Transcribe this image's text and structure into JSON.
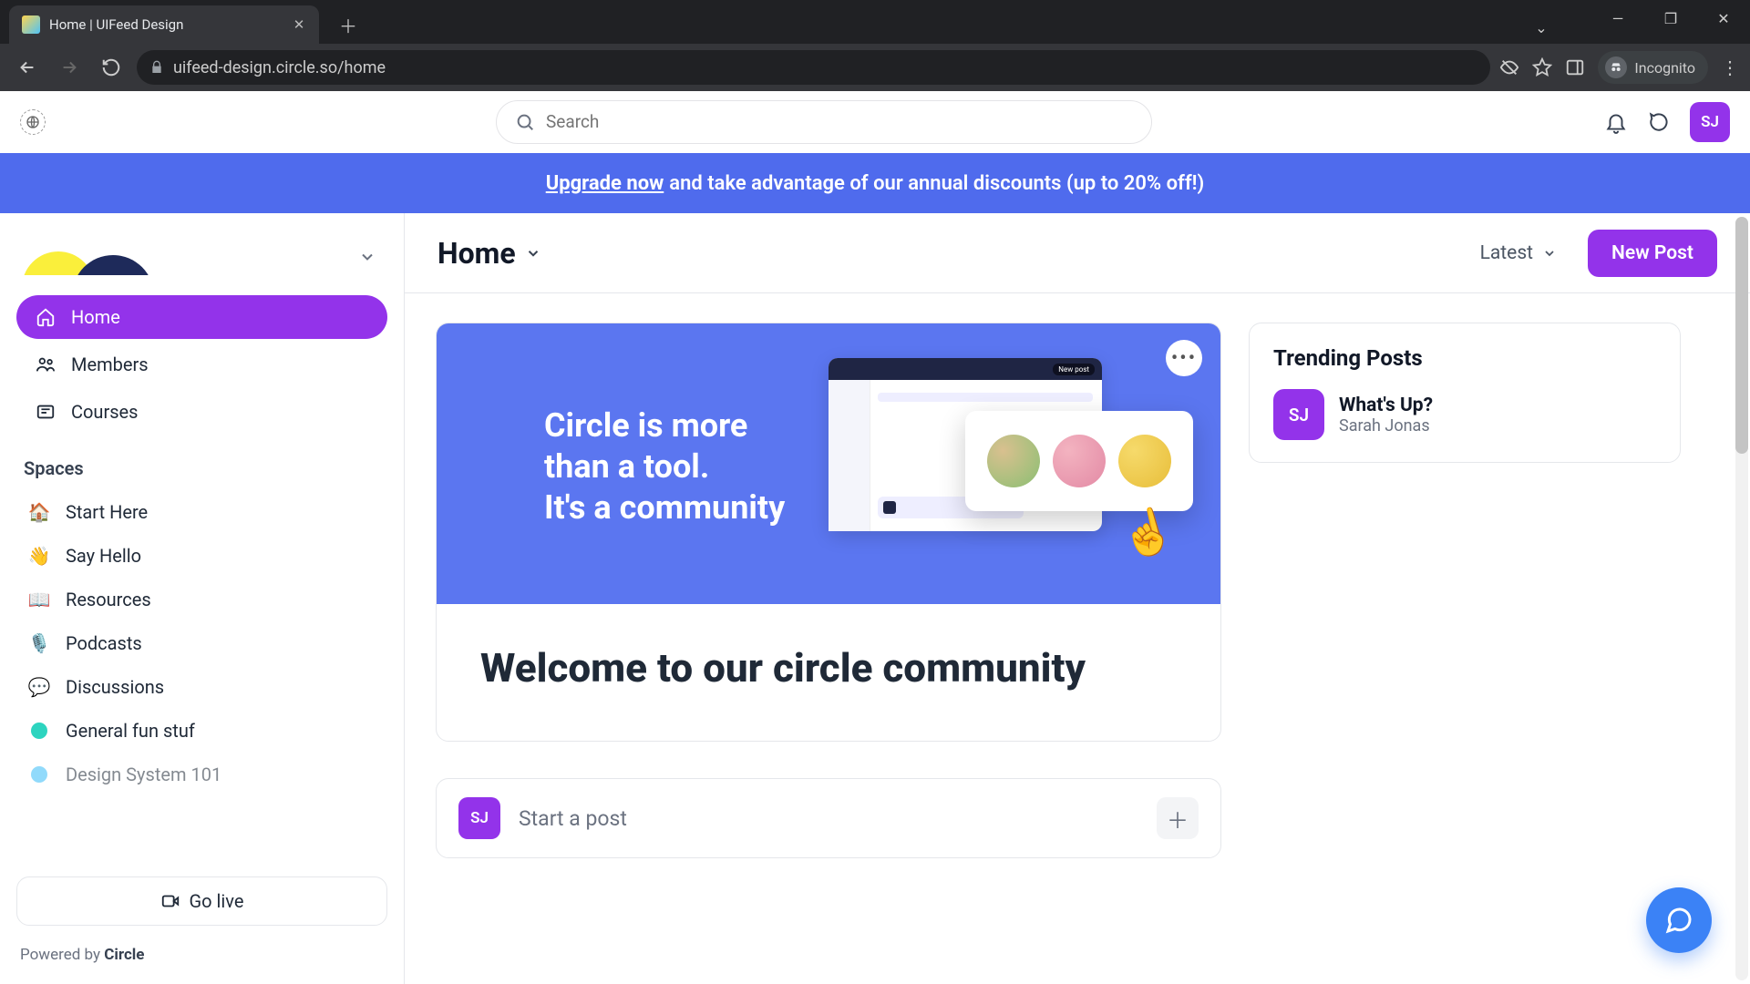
{
  "browser": {
    "tab_title": "Home | UIFeed Design",
    "url": "uifeed-design.circle.so/home",
    "incognito_label": "Incognito"
  },
  "topbar": {
    "search_placeholder": "Search",
    "avatar_initials": "SJ"
  },
  "banner": {
    "link": "Upgrade now",
    "rest": "  and take advantage of our annual discounts (up to 20% off!)"
  },
  "sidebar": {
    "nav": [
      {
        "label": "Home"
      },
      {
        "label": "Members"
      },
      {
        "label": "Courses"
      }
    ],
    "section_label": "Spaces",
    "spaces": [
      {
        "emoji": "🏠",
        "label": "Start Here"
      },
      {
        "emoji": "👋",
        "label": "Say Hello"
      },
      {
        "emoji": "📖",
        "label": "Resources"
      },
      {
        "emoji": "🎙️",
        "label": "Podcasts"
      },
      {
        "emoji": "💬",
        "label": "Discussions"
      },
      {
        "emoji": "",
        "label": "General fun stuf"
      },
      {
        "emoji": "",
        "label": "Design System 101"
      }
    ],
    "go_live": "Go live",
    "powered_prefix": "Powered by ",
    "powered_brand": "Circle"
  },
  "page": {
    "title": "Home",
    "sort": "Latest",
    "new_post": "New Post"
  },
  "hero": {
    "line1": "Circle is more",
    "line2": "than a tool.",
    "line3": "It's a community"
  },
  "welcome": {
    "heading": "Welcome to our circle community"
  },
  "compose": {
    "avatar_initials": "SJ",
    "placeholder": "Start a post"
  },
  "trending": {
    "title": "Trending Posts",
    "items": [
      {
        "avatar": "SJ",
        "title": "What's Up?",
        "author": "Sarah Jonas"
      }
    ]
  }
}
